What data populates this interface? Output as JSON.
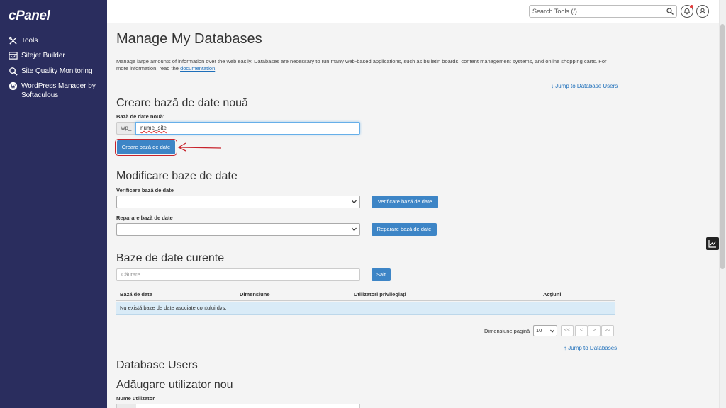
{
  "brand": {
    "logo_text": "cPanel"
  },
  "sidebar": {
    "items": [
      {
        "label": "Tools",
        "icon": "tools-icon"
      },
      {
        "label": "Sitejet Builder",
        "icon": "sitejet-icon"
      },
      {
        "label": "Site Quality Monitoring",
        "icon": "magnifier-icon"
      },
      {
        "label": "WordPress Manager by Softaculous",
        "icon": "wordpress-icon"
      }
    ]
  },
  "topbar": {
    "search_placeholder": "Search Tools (/)"
  },
  "page": {
    "title": "Manage My Databases",
    "description": "Manage large amounts of information over the web easily. Databases are necessary to run many web-based applications, such as bulletin boards, content management systems, and online shopping carts. For more information, read the",
    "description_link": "documentation",
    "description_end": ".",
    "jump_users": "Jump to Database Users"
  },
  "create_db": {
    "heading": "Creare bază de date nouă",
    "field_label": "Bază de date nouă:",
    "prefix": "wp_",
    "value": "nume_site",
    "button": "Creare bază de date"
  },
  "modify_db": {
    "heading": "Modificare baze de date",
    "check_label": "Verificare bază de date",
    "check_button": "Verificare bază de date",
    "repair_label": "Reparare bază de date",
    "repair_button": "Reparare bază de date"
  },
  "current_db": {
    "heading": "Baze de date curente",
    "search_placeholder": "Căutare",
    "search_button": "Salt",
    "columns": [
      "Bază de date",
      "Dimensiune",
      "Utilizatori privilegiați",
      "Acțiuni"
    ],
    "empty_message": "Nu există baze de date asociate contului dvs.",
    "page_size_label": "Dimensiune pagină",
    "page_size": "10",
    "pager": [
      "<<",
      "<",
      ">",
      ">>"
    ],
    "jump_databases": "Jump to Databases"
  },
  "db_users": {
    "heading": "Database Users",
    "add_heading": "Adăugare utilizator nou",
    "username_label": "Nume utilizator"
  },
  "colors": {
    "sidebar": "#2a2d5e",
    "accent": "#3d85c6",
    "link": "#1e6fba",
    "annotation": "#c8232c"
  }
}
